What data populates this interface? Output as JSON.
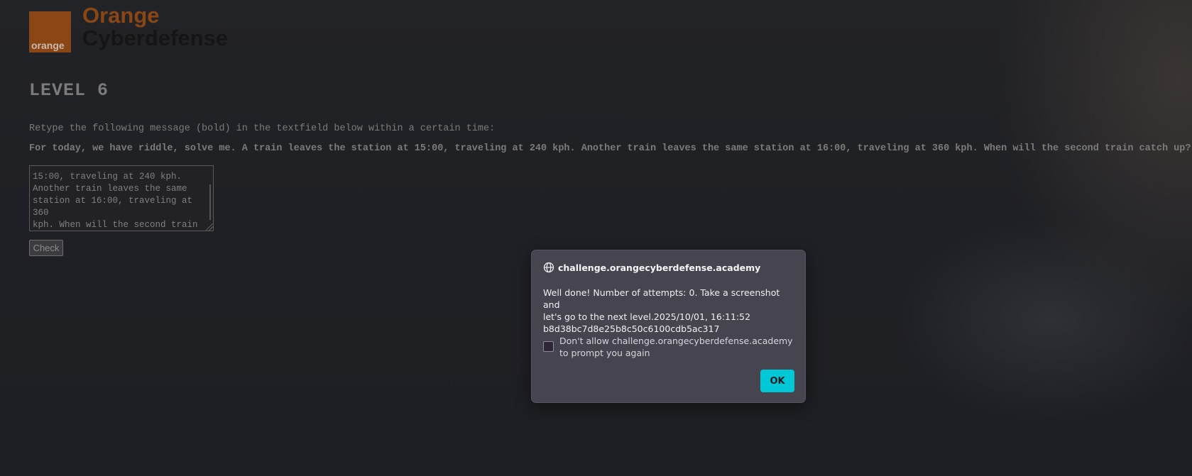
{
  "logo": {
    "word": "orange",
    "trademark": "™"
  },
  "brand": {
    "line1": "Orange",
    "line2": "Cyberdefense"
  },
  "level_title": "LEVEL 6",
  "instruction": "Retype the following message (bold) in the textfield below within a certain time:",
  "message": "For today, we have riddle, solve me. A train leaves the station at 15:00, traveling at 240 kph. Another train leaves the same station at 16:00, traveling at 360 kph. When will the second train catch up?",
  "answer_value": "15:00, traveling at 240 kph.\nAnother train leaves the same\nstation at 16:00, traveling at 360\nkph. When will the second train\ncatch up?",
  "check_label": "Check",
  "dialog": {
    "origin": "challenge.orangecyberdefense.academy",
    "message_line1": "Well done! Number of attempts: 0. Take a screenshot and",
    "message_line2": "let's go to the next level.2025/10/01, 16:11:52",
    "message_line3": "b8d38bc7d8e25b8c50c6100cdb5ac317",
    "checkbox_label": "Don't allow challenge.orangecyberdefense.academy to prompt you again",
    "ok_label": "OK"
  },
  "colors": {
    "brand_orange": "#8a4614",
    "ok_button": "#00c8d7",
    "dialog_bg": "#45444f"
  }
}
